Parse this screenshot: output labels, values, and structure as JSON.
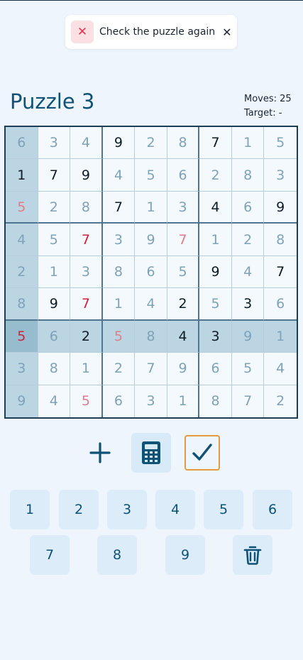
{
  "toast": {
    "message": "Check the puzzle again",
    "icon": "x-icon",
    "close_icon": "close-icon",
    "close_glyph": "✕",
    "icon_glyph": "✕"
  },
  "header": {
    "title": "Puzzle 3",
    "moves_label": "Moves: 25",
    "target_label": "Target: -"
  },
  "board": {
    "rows": [
      [
        {
          "v": "6",
          "s": "user"
        },
        {
          "v": "3",
          "s": "user"
        },
        {
          "v": "4",
          "s": "user"
        },
        {
          "v": "9",
          "s": "given"
        },
        {
          "v": "2",
          "s": "user"
        },
        {
          "v": "8",
          "s": "user"
        },
        {
          "v": "7",
          "s": "given"
        },
        {
          "v": "1",
          "s": "user"
        },
        {
          "v": "5",
          "s": "user"
        }
      ],
      [
        {
          "v": "1",
          "s": "given"
        },
        {
          "v": "7",
          "s": "given"
        },
        {
          "v": "9",
          "s": "given"
        },
        {
          "v": "4",
          "s": "user"
        },
        {
          "v": "5",
          "s": "user"
        },
        {
          "v": "6",
          "s": "user"
        },
        {
          "v": "2",
          "s": "user"
        },
        {
          "v": "8",
          "s": "user"
        },
        {
          "v": "3",
          "s": "user"
        }
      ],
      [
        {
          "v": "5",
          "s": "errsoft"
        },
        {
          "v": "2",
          "s": "user"
        },
        {
          "v": "8",
          "s": "user"
        },
        {
          "v": "7",
          "s": "given"
        },
        {
          "v": "1",
          "s": "user"
        },
        {
          "v": "3",
          "s": "user"
        },
        {
          "v": "4",
          "s": "given"
        },
        {
          "v": "6",
          "s": "user"
        },
        {
          "v": "9",
          "s": "given"
        }
      ],
      [
        {
          "v": "4",
          "s": "user"
        },
        {
          "v": "5",
          "s": "user"
        },
        {
          "v": "7",
          "s": "err"
        },
        {
          "v": "3",
          "s": "user"
        },
        {
          "v": "9",
          "s": "user"
        },
        {
          "v": "7",
          "s": "errsoft"
        },
        {
          "v": "1",
          "s": "user"
        },
        {
          "v": "2",
          "s": "user"
        },
        {
          "v": "8",
          "s": "user"
        }
      ],
      [
        {
          "v": "2",
          "s": "user"
        },
        {
          "v": "1",
          "s": "user"
        },
        {
          "v": "3",
          "s": "user"
        },
        {
          "v": "8",
          "s": "user"
        },
        {
          "v": "6",
          "s": "user"
        },
        {
          "v": "5",
          "s": "user"
        },
        {
          "v": "9",
          "s": "given"
        },
        {
          "v": "4",
          "s": "user"
        },
        {
          "v": "7",
          "s": "given"
        }
      ],
      [
        {
          "v": "8",
          "s": "user"
        },
        {
          "v": "9",
          "s": "given"
        },
        {
          "v": "7",
          "s": "err"
        },
        {
          "v": "1",
          "s": "user"
        },
        {
          "v": "4",
          "s": "user"
        },
        {
          "v": "2",
          "s": "given"
        },
        {
          "v": "5",
          "s": "user"
        },
        {
          "v": "3",
          "s": "given"
        },
        {
          "v": "6",
          "s": "user"
        }
      ],
      [
        {
          "v": "5",
          "s": "err"
        },
        {
          "v": "6",
          "s": "user"
        },
        {
          "v": "2",
          "s": "given"
        },
        {
          "v": "5",
          "s": "errsoft"
        },
        {
          "v": "8",
          "s": "user"
        },
        {
          "v": "4",
          "s": "given"
        },
        {
          "v": "3",
          "s": "given"
        },
        {
          "v": "9",
          "s": "user"
        },
        {
          "v": "1",
          "s": "user"
        }
      ],
      [
        {
          "v": "3",
          "s": "user"
        },
        {
          "v": "8",
          "s": "user"
        },
        {
          "v": "1",
          "s": "user"
        },
        {
          "v": "2",
          "s": "user"
        },
        {
          "v": "7",
          "s": "user"
        },
        {
          "v": "9",
          "s": "user"
        },
        {
          "v": "6",
          "s": "user"
        },
        {
          "v": "5",
          "s": "user"
        },
        {
          "v": "4",
          "s": "user"
        }
      ],
      [
        {
          "v": "9",
          "s": "user"
        },
        {
          "v": "4",
          "s": "user"
        },
        {
          "v": "5",
          "s": "errsoft"
        },
        {
          "v": "6",
          "s": "user"
        },
        {
          "v": "3",
          "s": "user"
        },
        {
          "v": "1",
          "s": "user"
        },
        {
          "v": "8",
          "s": "user"
        },
        {
          "v": "7",
          "s": "user"
        },
        {
          "v": "2",
          "s": "user"
        }
      ]
    ],
    "selected_row": 6,
    "selected_col": 0
  },
  "tools": [
    {
      "name": "add-note-button",
      "icon": "plus-icon"
    },
    {
      "name": "calculator-button",
      "icon": "calculator-icon"
    },
    {
      "name": "check-button",
      "icon": "checkmark-icon"
    }
  ],
  "keypad": {
    "row1": [
      "1",
      "2",
      "3",
      "4",
      "5",
      "6"
    ],
    "row2": [
      "7",
      "8",
      "9"
    ],
    "delete_icon": "trash-icon"
  },
  "colors": {
    "accent": "#0f5278",
    "check_border": "#e39b3d",
    "error": "#d21f3c",
    "highlight": "#bcd5e2",
    "selected": "#97bcce"
  }
}
